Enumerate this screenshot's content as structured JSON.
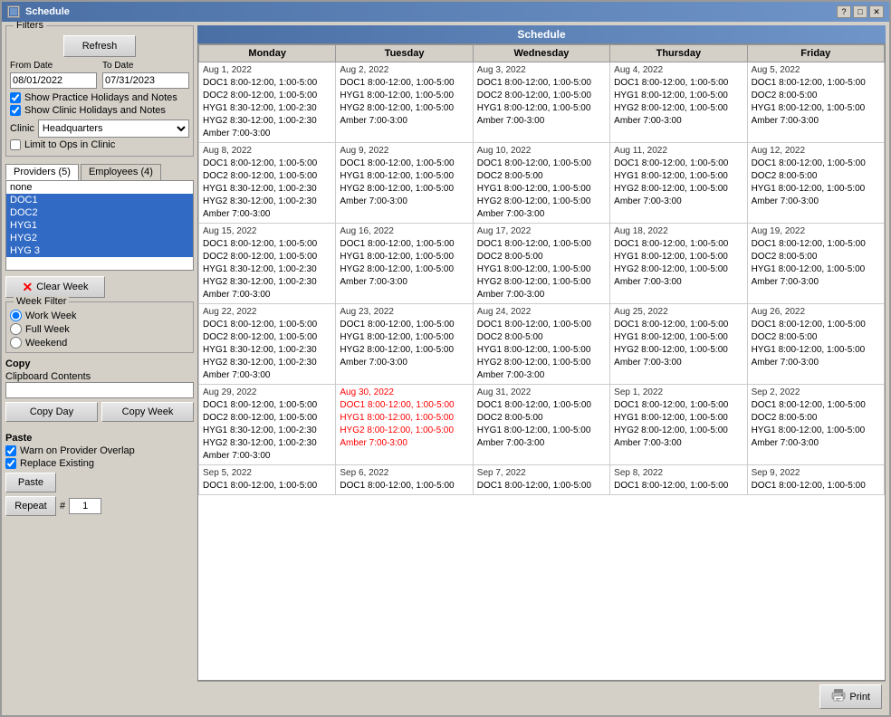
{
  "window": {
    "title": "Schedule",
    "help_btn": "?",
    "maximize_btn": "□",
    "close_btn": "✕"
  },
  "filters": {
    "group_label": "Filters",
    "refresh_btn": "Refresh",
    "from_date_label": "From Date",
    "from_date_value": "08/01/2022",
    "to_date_label": "To Date",
    "to_date_value": "07/31/2023",
    "show_practice_holidays": "Show Practice Holidays and Notes",
    "show_clinic_holidays": "Show Clinic Holidays and Notes",
    "clinic_label": "Clinic",
    "clinic_value": "Headquarters",
    "limit_label": "Limit to Ops in Clinic"
  },
  "providers": {
    "tab_providers": "Providers (5)",
    "tab_employees": "Employees (4)",
    "items": [
      {
        "label": "none",
        "selected": false
      },
      {
        "label": "DOC1",
        "selected": true
      },
      {
        "label": "DOC2",
        "selected": true
      },
      {
        "label": "HYG1",
        "selected": true
      },
      {
        "label": "HYG2",
        "selected": true
      },
      {
        "label": "HYG 3",
        "selected": true
      }
    ],
    "clear_week_btn": "Clear Week"
  },
  "week_filter": {
    "label": "Week Filter",
    "options": [
      {
        "label": "Work Week",
        "checked": true
      },
      {
        "label": "Full Week",
        "checked": false
      },
      {
        "label": "Weekend",
        "checked": false
      }
    ]
  },
  "copy": {
    "label": "Copy",
    "clipboard_label": "Clipboard Contents",
    "copy_day_btn": "Copy Day",
    "copy_week_btn": "Copy Week"
  },
  "paste": {
    "label": "Paste",
    "warn_label": "Warn on Provider Overlap",
    "replace_label": "Replace Existing",
    "paste_btn": "Paste",
    "repeat_btn": "Repeat",
    "repeat_num": "1",
    "hash_label": "#"
  },
  "schedule": {
    "title": "Schedule",
    "columns": [
      "Monday",
      "Tuesday",
      "Wednesday",
      "Thursday",
      "Friday"
    ],
    "weeks": [
      {
        "cells": [
          {
            "date": "Aug 1, 2022",
            "lines": [
              "DOC1 8:00-12:00, 1:00-5:00",
              "DOC2 8:00-12:00, 1:00-5:00",
              "HYG1 8:30-12:00, 1:00-2:30",
              "HYG2 8:30-12:00, 1:00-2:30",
              "Amber 7:00-3:00"
            ],
            "red": false
          },
          {
            "date": "Aug 2, 2022",
            "lines": [
              "DOC1 8:00-12:00, 1:00-5:00",
              "HYG1 8:00-12:00, 1:00-5:00",
              "HYG2 8:00-12:00, 1:00-5:00",
              "Amber 7:00-3:00"
            ],
            "red": false
          },
          {
            "date": "Aug 3, 2022",
            "lines": [
              "DOC1 8:00-12:00, 1:00-5:00",
              "DOC2 8:00-12:00, 1:00-5:00",
              "HYG1 8:00-12:00, 1:00-5:00",
              "Amber 7:00-3:00"
            ],
            "red": false
          },
          {
            "date": "Aug 4, 2022",
            "lines": [
              "DOC1 8:00-12:00, 1:00-5:00",
              "HYG1 8:00-12:00, 1:00-5:00",
              "HYG2 8:00-12:00, 1:00-5:00",
              "Amber 7:00-3:00"
            ],
            "red": false
          },
          {
            "date": "Aug 5, 2022",
            "lines": [
              "DOC1 8:00-12:00, 1:00-5:00",
              "DOC2 8:00-5:00",
              "HYG1 8:00-12:00, 1:00-5:00",
              "Amber 7:00-3:00"
            ],
            "red": false
          }
        ]
      },
      {
        "cells": [
          {
            "date": "Aug 8, 2022",
            "lines": [
              "DOC1 8:00-12:00, 1:00-5:00",
              "DOC2 8:00-12:00, 1:00-5:00",
              "HYG1 8:30-12:00, 1:00-2:30",
              "HYG2 8:30-12:00, 1:00-2:30",
              "Amber 7:00-3:00"
            ],
            "red": false
          },
          {
            "date": "Aug 9, 2022",
            "lines": [
              "DOC1 8:00-12:00, 1:00-5:00",
              "HYG1 8:00-12:00, 1:00-5:00",
              "HYG2 8:00-12:00, 1:00-5:00",
              "Amber 7:00-3:00"
            ],
            "red": false
          },
          {
            "date": "Aug 10, 2022",
            "lines": [
              "DOC1 8:00-12:00, 1:00-5:00",
              "DOC2 8:00-5:00",
              "HYG1 8:00-12:00, 1:00-5:00",
              "HYG2 8:00-12:00, 1:00-5:00",
              "Amber 7:00-3:00"
            ],
            "red": false
          },
          {
            "date": "Aug 11, 2022",
            "lines": [
              "DOC1 8:00-12:00, 1:00-5:00",
              "HYG1 8:00-12:00, 1:00-5:00",
              "HYG2 8:00-12:00, 1:00-5:00",
              "Amber 7:00-3:00"
            ],
            "red": false
          },
          {
            "date": "Aug 12, 2022",
            "lines": [
              "DOC1 8:00-12:00, 1:00-5:00",
              "DOC2 8:00-5:00",
              "HYG1 8:00-12:00, 1:00-5:00",
              "Amber 7:00-3:00"
            ],
            "red": false
          }
        ]
      },
      {
        "cells": [
          {
            "date": "Aug 15, 2022",
            "lines": [
              "DOC1 8:00-12:00, 1:00-5:00",
              "DOC2 8:00-12:00, 1:00-5:00",
              "HYG1 8:30-12:00, 1:00-2:30",
              "HYG2 8:30-12:00, 1:00-2:30",
              "Amber 7:00-3:00"
            ],
            "red": false
          },
          {
            "date": "Aug 16, 2022",
            "lines": [
              "DOC1 8:00-12:00, 1:00-5:00",
              "HYG1 8:00-12:00, 1:00-5:00",
              "HYG2 8:00-12:00, 1:00-5:00",
              "Amber 7:00-3:00"
            ],
            "red": false
          },
          {
            "date": "Aug 17, 2022",
            "lines": [
              "DOC1 8:00-12:00, 1:00-5:00",
              "DOC2 8:00-5:00",
              "HYG1 8:00-12:00, 1:00-5:00",
              "HYG2 8:00-12:00, 1:00-5:00",
              "Amber 7:00-3:00"
            ],
            "red": false
          },
          {
            "date": "Aug 18, 2022",
            "lines": [
              "DOC1 8:00-12:00, 1:00-5:00",
              "HYG1 8:00-12:00, 1:00-5:00",
              "HYG2 8:00-12:00, 1:00-5:00",
              "Amber 7:00-3:00"
            ],
            "red": false
          },
          {
            "date": "Aug 19, 2022",
            "lines": [
              "DOC1 8:00-12:00, 1:00-5:00",
              "DOC2 8:00-5:00",
              "HYG1 8:00-12:00, 1:00-5:00",
              "Amber 7:00-3:00"
            ],
            "red": false
          }
        ]
      },
      {
        "cells": [
          {
            "date": "Aug 22, 2022",
            "lines": [
              "DOC1 8:00-12:00, 1:00-5:00",
              "DOC2 8:00-12:00, 1:00-5:00",
              "HYG1 8:30-12:00, 1:00-2:30",
              "HYG2 8:30-12:00, 1:00-2:30",
              "Amber 7:00-3:00"
            ],
            "red": false
          },
          {
            "date": "Aug 23, 2022",
            "lines": [
              "DOC1 8:00-12:00, 1:00-5:00",
              "HYG1 8:00-12:00, 1:00-5:00",
              "HYG2 8:00-12:00, 1:00-5:00",
              "Amber 7:00-3:00"
            ],
            "red": false
          },
          {
            "date": "Aug 24, 2022",
            "lines": [
              "DOC1 8:00-12:00, 1:00-5:00",
              "DOC2 8:00-5:00",
              "HYG1 8:00-12:00, 1:00-5:00",
              "HYG2 8:00-12:00, 1:00-5:00",
              "Amber 7:00-3:00"
            ],
            "red": false
          },
          {
            "date": "Aug 25, 2022",
            "lines": [
              "DOC1 8:00-12:00, 1:00-5:00",
              "HYG1 8:00-12:00, 1:00-5:00",
              "HYG2 8:00-12:00, 1:00-5:00",
              "Amber 7:00-3:00"
            ],
            "red": false
          },
          {
            "date": "Aug 26, 2022",
            "lines": [
              "DOC1 8:00-12:00, 1:00-5:00",
              "DOC2 8:00-5:00",
              "HYG1 8:00-12:00, 1:00-5:00",
              "Amber 7:00-3:00"
            ],
            "red": false
          }
        ]
      },
      {
        "cells": [
          {
            "date": "Aug 29, 2022",
            "lines": [
              "DOC1 8:00-12:00, 1:00-5:00",
              "DOC2 8:00-12:00, 1:00-5:00",
              "HYG1 8:30-12:00, 1:00-2:30",
              "HYG2 8:30-12:00, 1:00-2:30",
              "Amber 7:00-3:00"
            ],
            "red": false
          },
          {
            "date": "Aug 30, 2022",
            "lines": [
              "DOC1 8:00-12:00, 1:00-5:00",
              "HYG1 8:00-12:00, 1:00-5:00",
              "HYG2 8:00-12:00, 1:00-5:00",
              "Amber 7:00-3:00"
            ],
            "red": true
          },
          {
            "date": "Aug 31, 2022",
            "lines": [
              "DOC1 8:00-12:00, 1:00-5:00",
              "DOC2 8:00-5:00",
              "HYG1 8:00-12:00, 1:00-5:00",
              "Amber 7:00-3:00"
            ],
            "red": false
          },
          {
            "date": "Sep 1, 2022",
            "lines": [
              "DOC1 8:00-12:00, 1:00-5:00",
              "HYG1 8:00-12:00, 1:00-5:00",
              "HYG2 8:00-12:00, 1:00-5:00",
              "Amber 7:00-3:00"
            ],
            "red": false
          },
          {
            "date": "Sep 2, 2022",
            "lines": [
              "DOC1 8:00-12:00, 1:00-5:00",
              "DOC2 8:00-5:00",
              "HYG1 8:00-12:00, 1:00-5:00",
              "Amber 7:00-3:00"
            ],
            "red": false
          }
        ]
      },
      {
        "cells": [
          {
            "date": "Sep 5, 2022",
            "lines": [
              "DOC1 8:00-12:00, 1:00-5:00"
            ],
            "red": false
          },
          {
            "date": "Sep 6, 2022",
            "lines": [
              "DOC1 8:00-12:00, 1:00-5:00"
            ],
            "red": false
          },
          {
            "date": "Sep 7, 2022",
            "lines": [
              "DOC1 8:00-12:00, 1:00-5:00"
            ],
            "red": false
          },
          {
            "date": "Sep 8, 2022",
            "lines": [
              "DOC1 8:00-12:00, 1:00-5:00"
            ],
            "red": false
          },
          {
            "date": "Sep 9, 2022",
            "lines": [
              "DOC1 8:00-12:00, 1:00-5:00"
            ],
            "red": false
          }
        ]
      }
    ]
  },
  "footer": {
    "print_btn": "Print"
  }
}
